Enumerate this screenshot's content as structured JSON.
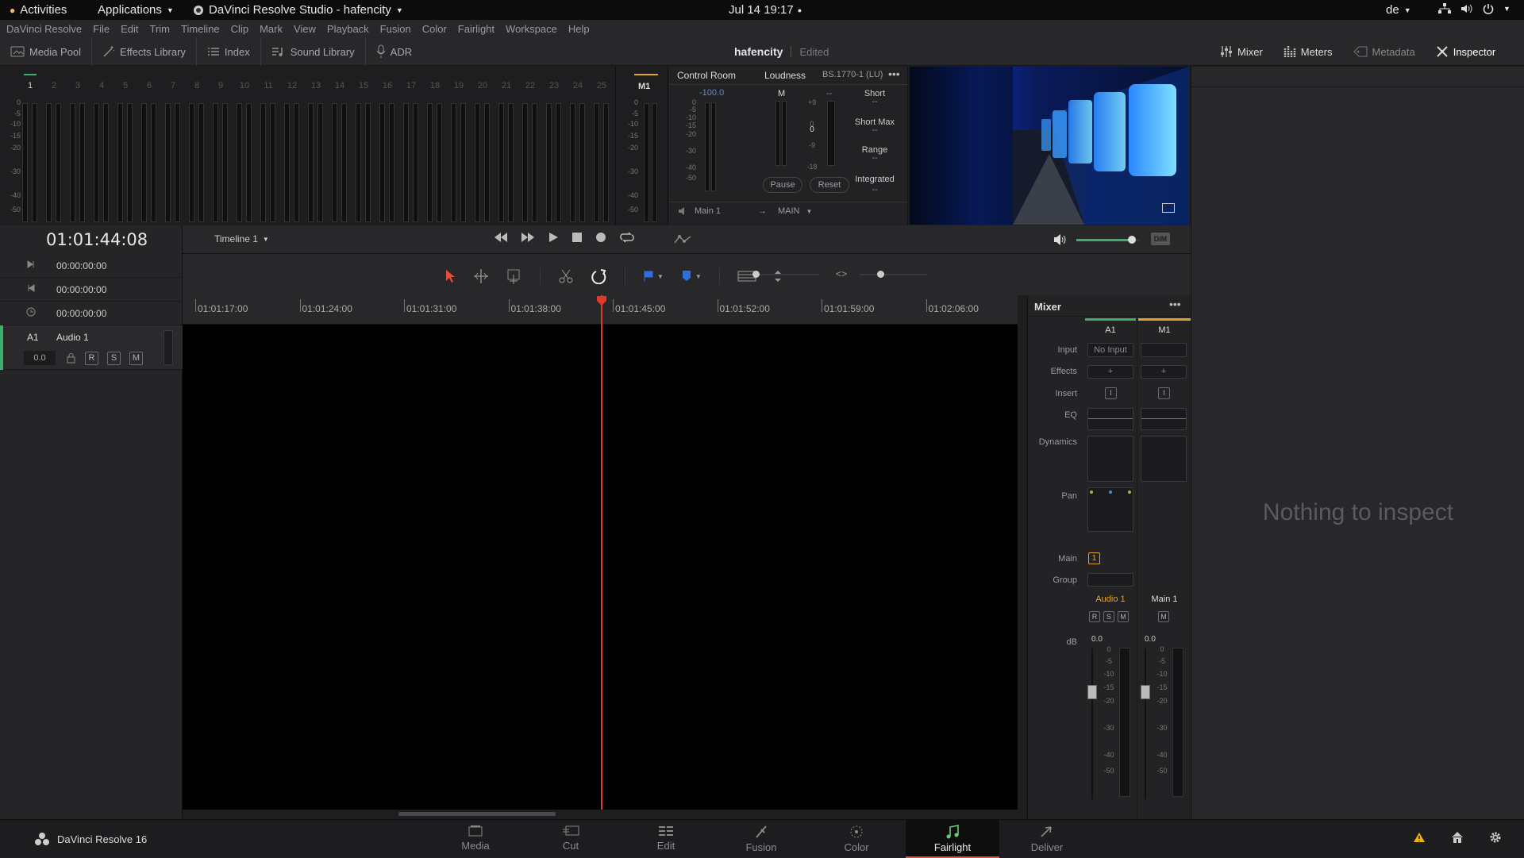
{
  "topbar": {
    "activities": "Activities",
    "applications": "Applications",
    "app_title": "DaVinci Resolve Studio - hafencity",
    "clock": "Jul 14  19:17",
    "lang": "de"
  },
  "menubar": [
    "DaVinci Resolve",
    "File",
    "Edit",
    "Trim",
    "Timeline",
    "Clip",
    "Mark",
    "View",
    "Playback",
    "Fusion",
    "Color",
    "Fairlight",
    "Workspace",
    "Help"
  ],
  "toolbar": {
    "left": [
      {
        "label": "Media Pool",
        "icon": "media-pool-icon"
      },
      {
        "label": "Effects Library",
        "icon": "effects-library-icon"
      },
      {
        "label": "Index",
        "icon": "index-icon"
      },
      {
        "label": "Sound Library",
        "icon": "sound-library-icon"
      },
      {
        "label": "ADR",
        "icon": "adr-icon"
      }
    ],
    "project_name": "hafencity",
    "project_status": "Edited",
    "right": [
      {
        "label": "Mixer",
        "icon": "mixer-icon"
      },
      {
        "label": "Meters",
        "icon": "meters-icon"
      },
      {
        "label": "Metadata",
        "icon": "metadata-icon"
      },
      {
        "label": "Inspector",
        "icon": "inspector-icon"
      }
    ]
  },
  "meters": {
    "channels": [
      "1",
      "2",
      "3",
      "4",
      "5",
      "6",
      "7",
      "8",
      "9",
      "10",
      "11",
      "12",
      "13",
      "14",
      "15",
      "16",
      "17",
      "18",
      "19",
      "20",
      "21",
      "22",
      "23",
      "24",
      "25"
    ],
    "scale": [
      "0",
      "-5",
      "-10",
      "-15",
      "-20",
      "-30",
      "-40",
      "-50"
    ],
    "master_label": "M1"
  },
  "control_room": {
    "title": "Control Room",
    "level": "-100.0",
    "scale": [
      "0",
      "-5",
      "-10",
      "-15",
      "-20",
      "-30",
      "-40",
      "-50"
    ],
    "output_label": "Main 1",
    "output_target": "MAIN"
  },
  "loudness": {
    "title": "Loudness",
    "standard": "BS.1770-1 (LU)",
    "m_label": "M",
    "m_value": "--",
    "scale": [
      "+9",
      "0",
      "-9",
      "-18"
    ],
    "zero": "0",
    "short": "Short",
    "short_value": "--",
    "short_max": "Short Max",
    "short_max_value": "--",
    "range": "Range",
    "range_value": "--",
    "integrated": "Integrated",
    "integrated_value": "--",
    "pause": "Pause",
    "reset": "Reset"
  },
  "transport": {
    "timecode": "01:01:44:08",
    "timeline_name": "Timeline 1",
    "dim": "DIM",
    "volume_fraction": 0.88
  },
  "tc_rows": [
    {
      "icon": "in-point-icon",
      "value": "00:00:00:00"
    },
    {
      "icon": "out-point-icon",
      "value": "00:00:00:00"
    },
    {
      "icon": "duration-icon",
      "value": "00:00:00:00"
    }
  ],
  "track": {
    "id": "A1",
    "name": "Audio 1",
    "volume": "0.0",
    "r": "R",
    "s": "S",
    "m": "M"
  },
  "ruler": [
    "01:01:17:00",
    "01:01:24:00",
    "01:01:31:00",
    "01:01:38:00",
    "01:01:45:00",
    "01:01:52:00",
    "01:01:59:00",
    "01:02:06:00"
  ],
  "mixer": {
    "title": "Mixer",
    "channels": [
      "A1",
      "M1"
    ],
    "rows": {
      "input": "Input",
      "effects": "Effects",
      "insert": "Insert",
      "eq": "EQ",
      "dynamics": "Dynamics",
      "pan": "Pan",
      "main": "Main",
      "group": "Group",
      "db": "dB"
    },
    "input_a1": "No Input",
    "effects_plus": "+",
    "insert_glyph": "I",
    "main_value": "1",
    "strip_names": [
      "Audio 1",
      "Main 1"
    ],
    "r": "R",
    "s": "S",
    "m": "M",
    "fader_values": [
      "0.0",
      "0.0"
    ],
    "fader_scale": [
      "0",
      "-5",
      "-10",
      "-15",
      "-20",
      "-30",
      "-40",
      "-50"
    ],
    "colors": {
      "a1": "#3fae6a",
      "m1": "#e0a526"
    }
  },
  "inspector": {
    "empty": "Nothing to inspect"
  },
  "bottom": {
    "app_name": "DaVinci Resolve 16",
    "pages": [
      {
        "label": "Media",
        "icon": "media-page-icon"
      },
      {
        "label": "Cut",
        "icon": "cut-page-icon"
      },
      {
        "label": "Edit",
        "icon": "edit-page-icon"
      },
      {
        "label": "Fusion",
        "icon": "fusion-page-icon"
      },
      {
        "label": "Color",
        "icon": "color-page-icon"
      },
      {
        "label": "Fairlight",
        "icon": "fairlight-page-icon"
      },
      {
        "label": "Deliver",
        "icon": "deliver-page-icon"
      }
    ],
    "active_page": "Fairlight"
  }
}
